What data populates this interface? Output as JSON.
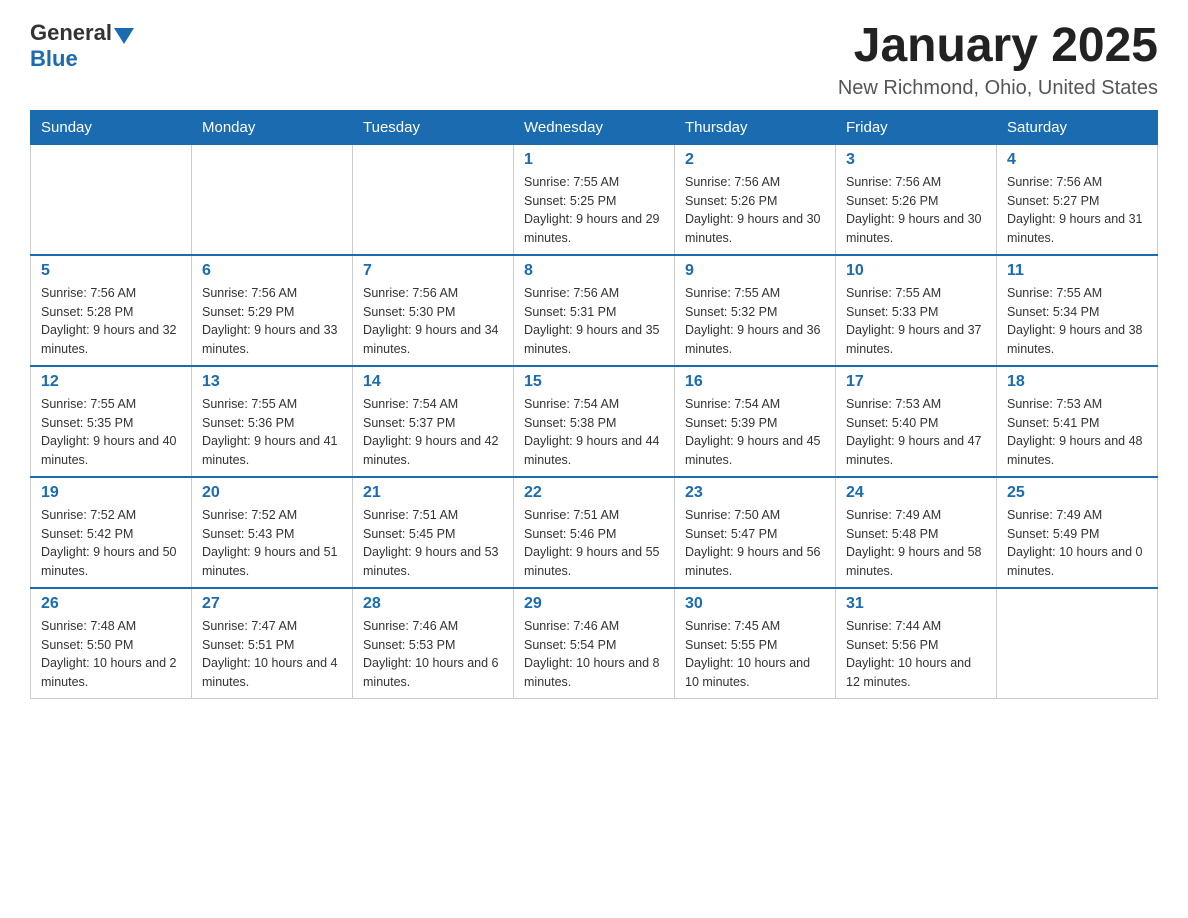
{
  "logo": {
    "text_general": "General",
    "text_blue": "Blue",
    "aria": "GeneralBlue Logo"
  },
  "title": "January 2025",
  "location": "New Richmond, Ohio, United States",
  "weekdays": [
    "Sunday",
    "Monday",
    "Tuesday",
    "Wednesday",
    "Thursday",
    "Friday",
    "Saturday"
  ],
  "weeks": [
    [
      {
        "day": "",
        "sunrise": "",
        "sunset": "",
        "daylight": ""
      },
      {
        "day": "",
        "sunrise": "",
        "sunset": "",
        "daylight": ""
      },
      {
        "day": "",
        "sunrise": "",
        "sunset": "",
        "daylight": ""
      },
      {
        "day": "1",
        "sunrise": "Sunrise: 7:55 AM",
        "sunset": "Sunset: 5:25 PM",
        "daylight": "Daylight: 9 hours and 29 minutes."
      },
      {
        "day": "2",
        "sunrise": "Sunrise: 7:56 AM",
        "sunset": "Sunset: 5:26 PM",
        "daylight": "Daylight: 9 hours and 30 minutes."
      },
      {
        "day": "3",
        "sunrise": "Sunrise: 7:56 AM",
        "sunset": "Sunset: 5:26 PM",
        "daylight": "Daylight: 9 hours and 30 minutes."
      },
      {
        "day": "4",
        "sunrise": "Sunrise: 7:56 AM",
        "sunset": "Sunset: 5:27 PM",
        "daylight": "Daylight: 9 hours and 31 minutes."
      }
    ],
    [
      {
        "day": "5",
        "sunrise": "Sunrise: 7:56 AM",
        "sunset": "Sunset: 5:28 PM",
        "daylight": "Daylight: 9 hours and 32 minutes."
      },
      {
        "day": "6",
        "sunrise": "Sunrise: 7:56 AM",
        "sunset": "Sunset: 5:29 PM",
        "daylight": "Daylight: 9 hours and 33 minutes."
      },
      {
        "day": "7",
        "sunrise": "Sunrise: 7:56 AM",
        "sunset": "Sunset: 5:30 PM",
        "daylight": "Daylight: 9 hours and 34 minutes."
      },
      {
        "day": "8",
        "sunrise": "Sunrise: 7:56 AM",
        "sunset": "Sunset: 5:31 PM",
        "daylight": "Daylight: 9 hours and 35 minutes."
      },
      {
        "day": "9",
        "sunrise": "Sunrise: 7:55 AM",
        "sunset": "Sunset: 5:32 PM",
        "daylight": "Daylight: 9 hours and 36 minutes."
      },
      {
        "day": "10",
        "sunrise": "Sunrise: 7:55 AM",
        "sunset": "Sunset: 5:33 PM",
        "daylight": "Daylight: 9 hours and 37 minutes."
      },
      {
        "day": "11",
        "sunrise": "Sunrise: 7:55 AM",
        "sunset": "Sunset: 5:34 PM",
        "daylight": "Daylight: 9 hours and 38 minutes."
      }
    ],
    [
      {
        "day": "12",
        "sunrise": "Sunrise: 7:55 AM",
        "sunset": "Sunset: 5:35 PM",
        "daylight": "Daylight: 9 hours and 40 minutes."
      },
      {
        "day": "13",
        "sunrise": "Sunrise: 7:55 AM",
        "sunset": "Sunset: 5:36 PM",
        "daylight": "Daylight: 9 hours and 41 minutes."
      },
      {
        "day": "14",
        "sunrise": "Sunrise: 7:54 AM",
        "sunset": "Sunset: 5:37 PM",
        "daylight": "Daylight: 9 hours and 42 minutes."
      },
      {
        "day": "15",
        "sunrise": "Sunrise: 7:54 AM",
        "sunset": "Sunset: 5:38 PM",
        "daylight": "Daylight: 9 hours and 44 minutes."
      },
      {
        "day": "16",
        "sunrise": "Sunrise: 7:54 AM",
        "sunset": "Sunset: 5:39 PM",
        "daylight": "Daylight: 9 hours and 45 minutes."
      },
      {
        "day": "17",
        "sunrise": "Sunrise: 7:53 AM",
        "sunset": "Sunset: 5:40 PM",
        "daylight": "Daylight: 9 hours and 47 minutes."
      },
      {
        "day": "18",
        "sunrise": "Sunrise: 7:53 AM",
        "sunset": "Sunset: 5:41 PM",
        "daylight": "Daylight: 9 hours and 48 minutes."
      }
    ],
    [
      {
        "day": "19",
        "sunrise": "Sunrise: 7:52 AM",
        "sunset": "Sunset: 5:42 PM",
        "daylight": "Daylight: 9 hours and 50 minutes."
      },
      {
        "day": "20",
        "sunrise": "Sunrise: 7:52 AM",
        "sunset": "Sunset: 5:43 PM",
        "daylight": "Daylight: 9 hours and 51 minutes."
      },
      {
        "day": "21",
        "sunrise": "Sunrise: 7:51 AM",
        "sunset": "Sunset: 5:45 PM",
        "daylight": "Daylight: 9 hours and 53 minutes."
      },
      {
        "day": "22",
        "sunrise": "Sunrise: 7:51 AM",
        "sunset": "Sunset: 5:46 PM",
        "daylight": "Daylight: 9 hours and 55 minutes."
      },
      {
        "day": "23",
        "sunrise": "Sunrise: 7:50 AM",
        "sunset": "Sunset: 5:47 PM",
        "daylight": "Daylight: 9 hours and 56 minutes."
      },
      {
        "day": "24",
        "sunrise": "Sunrise: 7:49 AM",
        "sunset": "Sunset: 5:48 PM",
        "daylight": "Daylight: 9 hours and 58 minutes."
      },
      {
        "day": "25",
        "sunrise": "Sunrise: 7:49 AM",
        "sunset": "Sunset: 5:49 PM",
        "daylight": "Daylight: 10 hours and 0 minutes."
      }
    ],
    [
      {
        "day": "26",
        "sunrise": "Sunrise: 7:48 AM",
        "sunset": "Sunset: 5:50 PM",
        "daylight": "Daylight: 10 hours and 2 minutes."
      },
      {
        "day": "27",
        "sunrise": "Sunrise: 7:47 AM",
        "sunset": "Sunset: 5:51 PM",
        "daylight": "Daylight: 10 hours and 4 minutes."
      },
      {
        "day": "28",
        "sunrise": "Sunrise: 7:46 AM",
        "sunset": "Sunset: 5:53 PM",
        "daylight": "Daylight: 10 hours and 6 minutes."
      },
      {
        "day": "29",
        "sunrise": "Sunrise: 7:46 AM",
        "sunset": "Sunset: 5:54 PM",
        "daylight": "Daylight: 10 hours and 8 minutes."
      },
      {
        "day": "30",
        "sunrise": "Sunrise: 7:45 AM",
        "sunset": "Sunset: 5:55 PM",
        "daylight": "Daylight: 10 hours and 10 minutes."
      },
      {
        "day": "31",
        "sunrise": "Sunrise: 7:44 AM",
        "sunset": "Sunset: 5:56 PM",
        "daylight": "Daylight: 10 hours and 12 minutes."
      },
      {
        "day": "",
        "sunrise": "",
        "sunset": "",
        "daylight": ""
      }
    ]
  ]
}
